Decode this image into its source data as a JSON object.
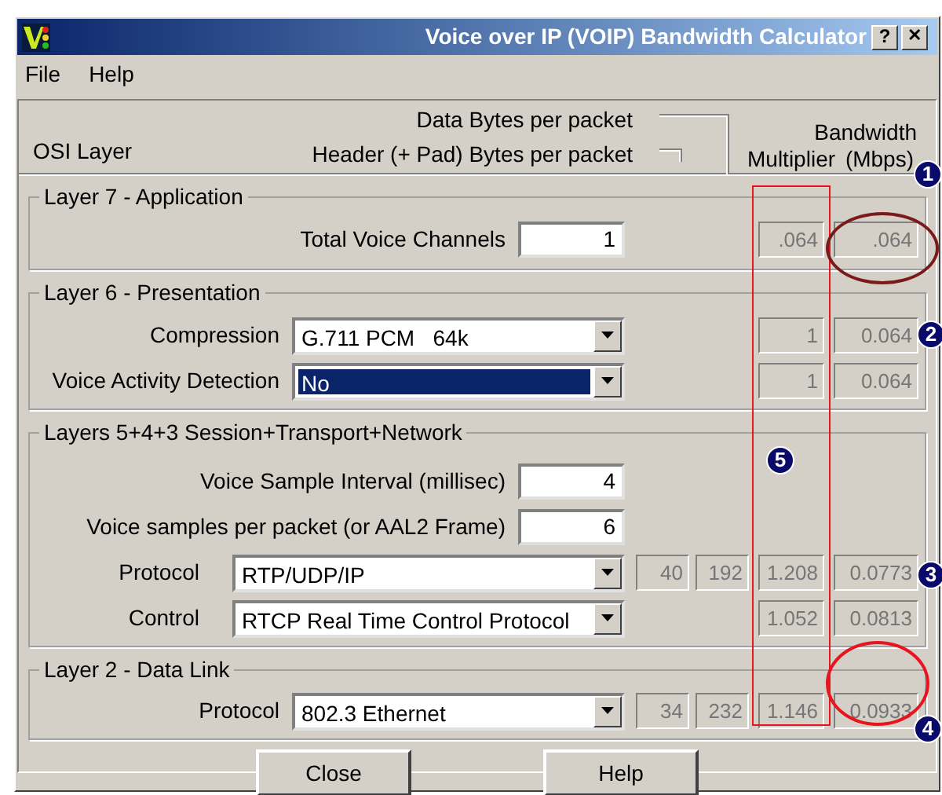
{
  "window": {
    "title": "Voice over IP (VOIP) Bandwidth Calculator",
    "help_button": "?",
    "close_button": "✕"
  },
  "menu": [
    "File",
    "Help"
  ],
  "header": {
    "osi_layer": "OSI Layer",
    "data_bytes": "Data Bytes per packet",
    "header_bytes": "Header (+ Pad) Bytes per packet",
    "bandwidth": "Bandwidth",
    "multiplier": "Multiplier",
    "mbps": "(Mbps)"
  },
  "sections": [
    {
      "title": "Layer 7 - Application",
      "rows": [
        {
          "kind": "number",
          "label": "Total Voice Channels",
          "value": "1",
          "multiplier": ".064",
          "bandwidth": ".064"
        }
      ]
    },
    {
      "title": "Layer 6 - Presentation",
      "rows": [
        {
          "kind": "dropdown",
          "label": "Compression",
          "value": "G.711 PCM   64k",
          "highlighted": false,
          "multiplier": "1",
          "bandwidth": "0.064"
        },
        {
          "kind": "dropdown",
          "label": "Voice Activity Detection",
          "value": "No",
          "highlighted": true,
          "multiplier": "1",
          "bandwidth": "0.064"
        }
      ]
    },
    {
      "title": "Layers 5+4+3 Session+Transport+Network",
      "rows": [
        {
          "kind": "number",
          "label": "Voice Sample Interval (millisec)",
          "value": "4"
        },
        {
          "kind": "number",
          "label": "Voice samples per packet (or AAL2 Frame)",
          "value": "6"
        },
        {
          "kind": "dropdown",
          "label": "Protocol",
          "value": "RTP/UDP/IP",
          "highlighted": false,
          "header_bytes": "40",
          "data_bytes": "192",
          "multiplier": "1.208",
          "bandwidth": "0.0773"
        },
        {
          "kind": "dropdown",
          "label": "Control",
          "value": "RTCP Real Time Control Protocol",
          "highlighted": false,
          "multiplier": "1.052",
          "bandwidth": "0.0813"
        }
      ]
    },
    {
      "title": "Layer 2 - Data Link",
      "rows": [
        {
          "kind": "dropdown",
          "label": "Protocol",
          "value": "802.3 Ethernet",
          "highlighted": false,
          "header_bytes": "34",
          "data_bytes": "232",
          "multiplier": "1.146",
          "bandwidth": "0.0933"
        }
      ]
    }
  ],
  "buttons": [
    "Close",
    "Help"
  ],
  "annotations": {
    "badges": [
      "1",
      "2",
      "3",
      "4",
      "5"
    ],
    "ellipses": [
      {
        "color": "#7b1a1a"
      },
      {
        "color": "#e8141e"
      }
    ],
    "column_frame": {
      "color": "#e8141e"
    }
  }
}
